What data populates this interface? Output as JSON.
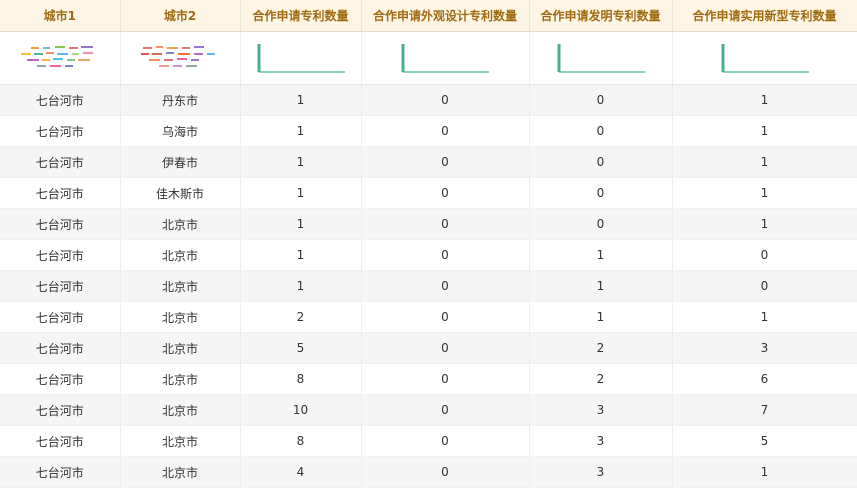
{
  "columns": [
    "城市1",
    "城市2",
    "合作申请专利数量",
    "合作申请外观设计专利数量",
    "合作申请发明专利数量",
    "合作申请实用新型专利数量"
  ],
  "sparkline_color": "#4bb08a",
  "rows": [
    [
      "七台河市",
      "丹东市",
      "1",
      "0",
      "0",
      "1"
    ],
    [
      "七台河市",
      "乌海市",
      "1",
      "0",
      "0",
      "1"
    ],
    [
      "七台河市",
      "伊春市",
      "1",
      "0",
      "0",
      "1"
    ],
    [
      "七台河市",
      "佳木斯市",
      "1",
      "0",
      "0",
      "1"
    ],
    [
      "七台河市",
      "北京市",
      "1",
      "0",
      "0",
      "1"
    ],
    [
      "七台河市",
      "北京市",
      "1",
      "0",
      "1",
      "0"
    ],
    [
      "七台河市",
      "北京市",
      "1",
      "0",
      "1",
      "0"
    ],
    [
      "七台河市",
      "北京市",
      "2",
      "0",
      "1",
      "1"
    ],
    [
      "七台河市",
      "北京市",
      "5",
      "0",
      "2",
      "3"
    ],
    [
      "七台河市",
      "北京市",
      "8",
      "0",
      "2",
      "6"
    ],
    [
      "七台河市",
      "北京市",
      "10",
      "0",
      "3",
      "7"
    ],
    [
      "七台河市",
      "北京市",
      "8",
      "0",
      "3",
      "5"
    ],
    [
      "七台河市",
      "北京市",
      "4",
      "0",
      "3",
      "1"
    ]
  ]
}
